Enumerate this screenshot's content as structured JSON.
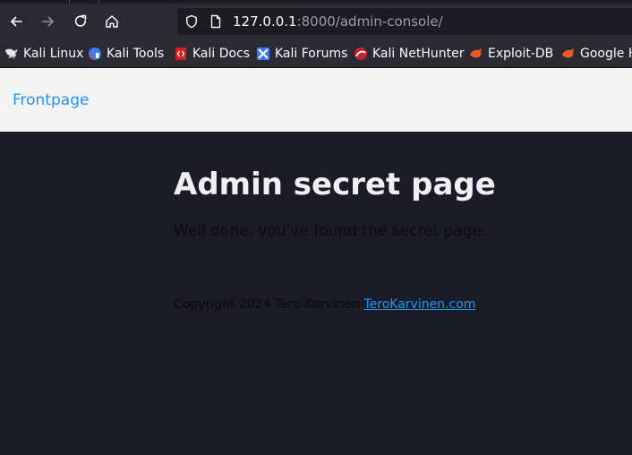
{
  "browser": {
    "url_host": "127.0.0.1",
    "url_rest": ":8000/admin-console/"
  },
  "bookmarks": [
    {
      "label": "Kali Linux",
      "icon": "kali-dragon-icon"
    },
    {
      "label": "Kali Tools",
      "icon": "kali-tools-icon"
    },
    {
      "label": "Kali Docs",
      "icon": "kali-docs-icon"
    },
    {
      "label": "Kali Forums",
      "icon": "kali-forums-icon"
    },
    {
      "label": "Kali NetHunter",
      "icon": "kali-nethunter-icon"
    },
    {
      "label": "Exploit-DB",
      "icon": "exploit-db-icon"
    },
    {
      "label": "Google H",
      "icon": "google-hacking-db-icon"
    }
  ],
  "page": {
    "nav_link": "Frontpage",
    "title": "Admin secret page",
    "lead": "Well done, you've found the secret page.",
    "footer_text": "Copyright 2024 Tero Karvinen ",
    "footer_link": "TeroKarvinen.com"
  },
  "colors": {
    "chrome_bg": "#2b2a33",
    "urlbar_bg": "#1c1b22",
    "header_bg": "#f4f4f4",
    "body_bg": "#1a1b26",
    "link": "#2196f3"
  }
}
